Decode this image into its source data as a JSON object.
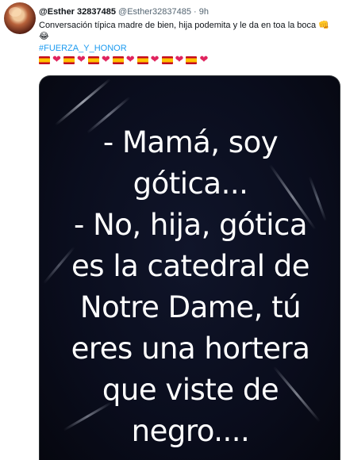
{
  "tweet": {
    "author_name": "@Esther 32837485",
    "handle": "@Esther32837485",
    "separator": "·",
    "time": "9h",
    "text": "Conversación típica madre de bien, hija podemita y le da en toa la boca",
    "text_emoji_1": "👊",
    "text_emoji_2": "😂",
    "hashtag": "#FUERZA_Y_HONOR",
    "emoji_row": [
      "flag-spain",
      "heart",
      "flag-spain",
      "heart",
      "flag-spain",
      "heart",
      "flag-spain",
      "heart",
      "flag-spain",
      "heart",
      "flag-spain",
      "heart",
      "flag-spain",
      "heart"
    ],
    "heart_glyph": "❤"
  },
  "media": {
    "lines": [
      "- Mamá, soy",
      "gótica...",
      "- No, hija, gótica",
      "es la catedral de",
      "Notre Dame, tú",
      "eres una hortera",
      "que viste de",
      "negro...."
    ]
  },
  "colors": {
    "link": "#1d9bf0",
    "heart": "#e0245e",
    "secondary_text": "#536471",
    "image_background": "#0a0d1d"
  }
}
